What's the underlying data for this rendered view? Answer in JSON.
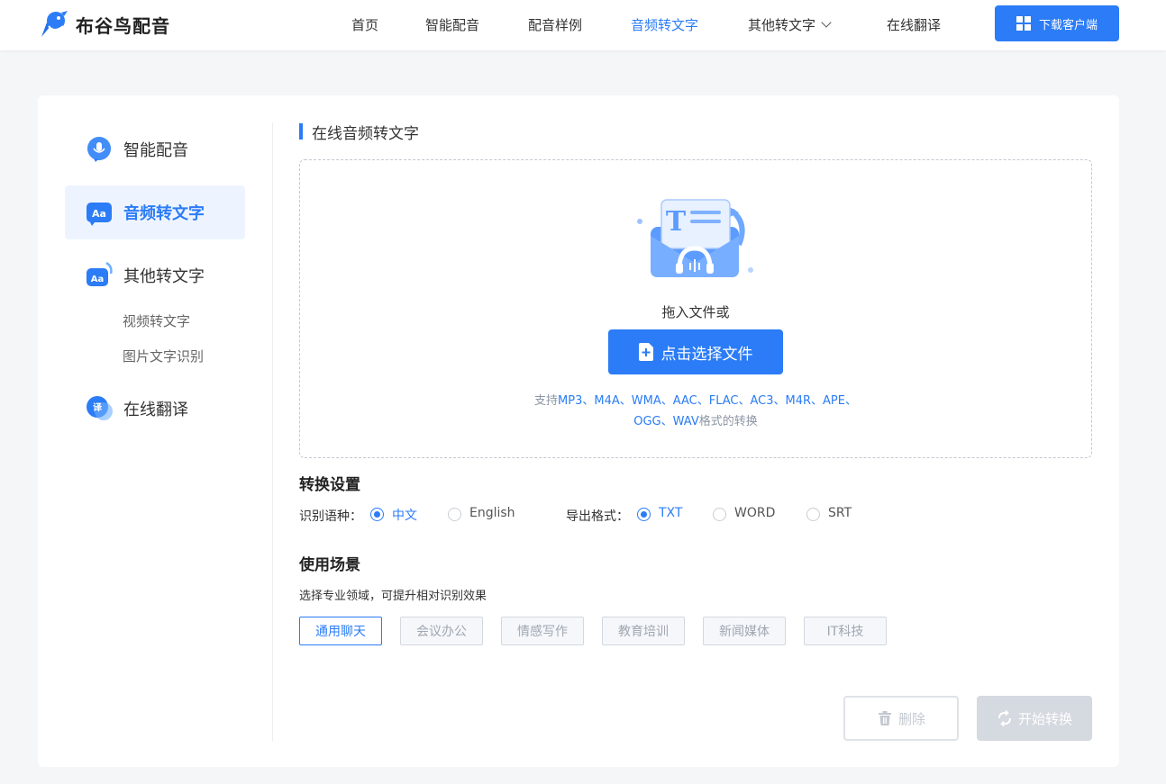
{
  "header": {
    "brand": "布谷鸟配音",
    "nav": [
      {
        "label": "首页"
      },
      {
        "label": "智能配音"
      },
      {
        "label": "配音样例"
      },
      {
        "label": "音频转文字",
        "active": true
      },
      {
        "label": "其他转文字",
        "dropdown": true
      },
      {
        "label": "在线翻译"
      }
    ],
    "download_label": "下载客户端"
  },
  "sidebar": {
    "items": [
      {
        "label": "智能配音",
        "icon": "mic-bubble-icon"
      },
      {
        "label": "音频转文字",
        "icon": "aa-audio-icon",
        "active": true
      },
      {
        "label": "其他转文字",
        "icon": "aa-other-icon"
      },
      {
        "label": "在线翻译",
        "icon": "translate-bubble-icon"
      }
    ],
    "sub_items": [
      "视频转文字",
      "图片文字识别"
    ]
  },
  "main": {
    "title": "在线音频转文字",
    "drop_text": "拖入文件或",
    "choose_label": "点击选择文件",
    "support_prefix": "支持",
    "support_line1": "MP3、M4A、WMA、AAC、FLAC、AC3、M4R、APE、",
    "support_line2": "OGG、WAV",
    "support_suffix": "格式的转换"
  },
  "settings": {
    "title": "转换设置",
    "language_label": "识别语种：",
    "languages": [
      {
        "label": "中文",
        "checked": true
      },
      {
        "label": "English",
        "checked": false
      }
    ],
    "format_label": "导出格式：",
    "formats": [
      {
        "label": "TXT",
        "checked": true
      },
      {
        "label": "WORD",
        "checked": false
      },
      {
        "label": "SRT",
        "checked": false
      }
    ]
  },
  "scenes": {
    "title": "使用场景",
    "tip": "选择专业领域，可提升相对识别效果",
    "tags": [
      {
        "label": "通用聊天",
        "active": true
      },
      {
        "label": "会议办公"
      },
      {
        "label": "情感写作"
      },
      {
        "label": "教育培训"
      },
      {
        "label": "新闻媒体"
      },
      {
        "label": "IT科技"
      }
    ]
  },
  "actions": {
    "delete_label": "删除",
    "start_label": "开始转换"
  },
  "colors": {
    "accent": "#2b7cf6",
    "disabled": "#d5d9e0"
  }
}
